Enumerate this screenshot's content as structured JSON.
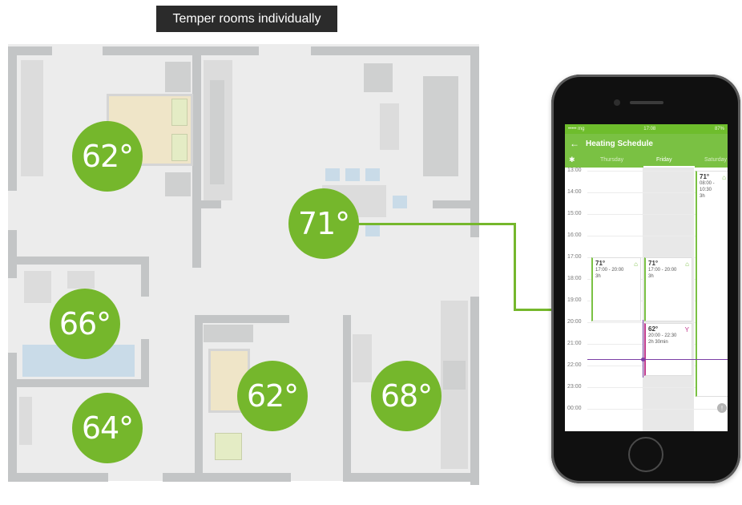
{
  "caption": "Temper rooms individually",
  "rooms": [
    {
      "name": "bedroom",
      "temperature": "62°"
    },
    {
      "name": "living-room",
      "temperature": "71°"
    },
    {
      "name": "bathroom",
      "temperature": "66°"
    },
    {
      "name": "small-room",
      "temperature": "64°"
    },
    {
      "name": "kids-room",
      "temperature": "62°"
    },
    {
      "name": "kitchen",
      "temperature": "68°"
    }
  ],
  "accent_color": "#75b72c",
  "phone": {
    "status": {
      "carrier": "••••• mg",
      "time": "17:08",
      "battery": "87%"
    },
    "title": "Heating Schedule",
    "days": [
      "Thursday",
      "Friday",
      "Saturday"
    ],
    "selected_day": "Friday",
    "times": [
      "13:00",
      "14:00",
      "15:00",
      "16:00",
      "17:00",
      "18:00",
      "19:00",
      "20:00",
      "21:00",
      "22:00",
      "23:00",
      "00:00"
    ],
    "events": [
      {
        "temp": "71°",
        "range": "17:00 - 20:00",
        "duration": "3h",
        "icon": "home-icon"
      },
      {
        "temp": "71°",
        "range": "17:00 - 20:00",
        "duration": "3h",
        "icon": "home-icon"
      },
      {
        "temp": "62°",
        "range": "20:00 - 22:30",
        "duration": "2h 30min",
        "icon": "cocktail-icon"
      },
      {
        "temp": "71°",
        "range": "08:00 - 10:30",
        "duration": "3h",
        "icon": "home-icon"
      }
    ]
  }
}
